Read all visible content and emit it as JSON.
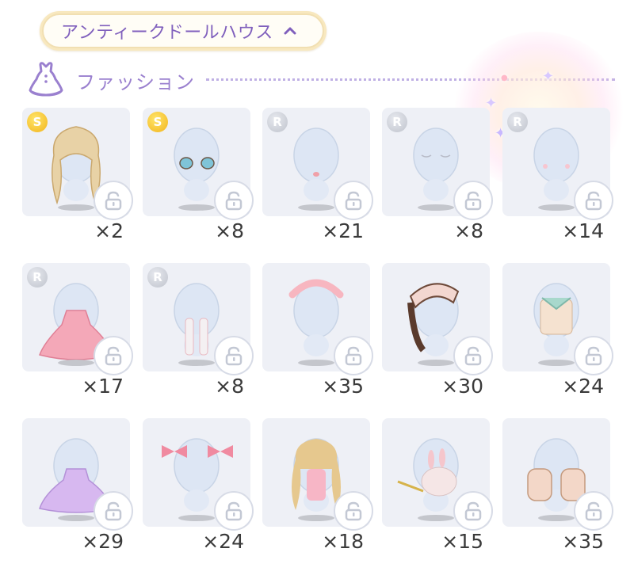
{
  "header": {
    "title": "アンティークドールハウス",
    "chevron": "chevron-up-icon"
  },
  "section": {
    "title": "ファッション",
    "icon": "dress-icon"
  },
  "colors": {
    "accent": "#8060bd",
    "pill_border": "#f8e8bf",
    "card_bg": "#eef0f6"
  },
  "items": [
    {
      "rarity": "S",
      "count": "×2",
      "art": "hair-icon"
    },
    {
      "rarity": "S",
      "count": "×8",
      "art": "eyes-icon"
    },
    {
      "rarity": "R",
      "count": "×21",
      "art": "lips-icon"
    },
    {
      "rarity": "R",
      "count": "×8",
      "art": "eyes-closed-icon"
    },
    {
      "rarity": "R",
      "count": "×14",
      "art": "face-blush-icon"
    },
    {
      "rarity": "R",
      "count": "×17",
      "art": "dress-icon"
    },
    {
      "rarity": "R",
      "count": "×8",
      "art": "stockings-icon"
    },
    {
      "rarity": "",
      "count": "×35",
      "art": "headband-icon"
    },
    {
      "rarity": "",
      "count": "×30",
      "art": "hat-icon"
    },
    {
      "rarity": "",
      "count": "×24",
      "art": "outfit-icon"
    },
    {
      "rarity": "",
      "count": "×29",
      "art": "skirt-icon"
    },
    {
      "rarity": "",
      "count": "×24",
      "art": "hair-bows-icon"
    },
    {
      "rarity": "",
      "count": "×18",
      "art": "doll-outfit-icon"
    },
    {
      "rarity": "",
      "count": "×15",
      "art": "bunny-plush-icon"
    },
    {
      "rarity": "",
      "count": "×35",
      "art": "boots-icon"
    }
  ]
}
